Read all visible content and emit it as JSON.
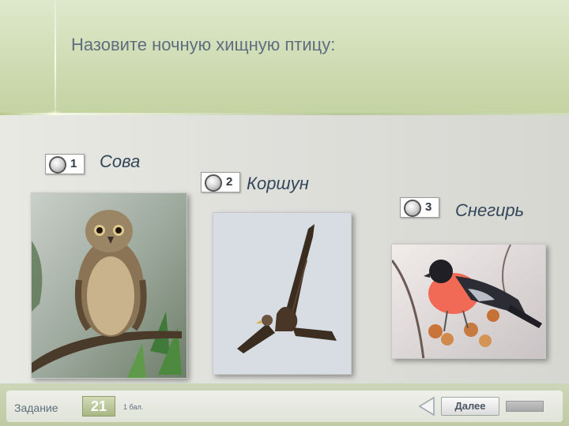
{
  "question": "Назовите ночную хищную птицу:",
  "options": [
    {
      "number": "1",
      "label": "Сова",
      "image": "owl-photo"
    },
    {
      "number": "2",
      "label": "Коршун",
      "image": "kite-photo"
    },
    {
      "number": "3",
      "label": "Снегирь",
      "image": "bullfinch-photo"
    }
  ],
  "footer": {
    "task_label": "Задание",
    "task_number": "21",
    "points": "1 бал.",
    "next_label": "Далее"
  },
  "colors": {
    "header_green": "#cfdcb3",
    "question_text": "#5e6e7e",
    "task_badge": "#a9b783"
  }
}
